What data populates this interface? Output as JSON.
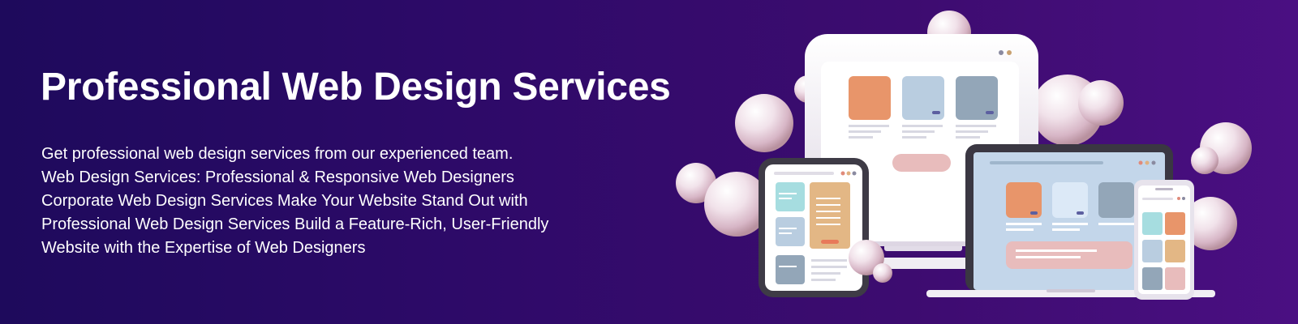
{
  "hero": {
    "heading": "Professional Web Design Services",
    "description_lines": [
      "Get professional web design services from our experienced team.",
      "Web Design Services: Professional & Responsive Web Designers",
      "Corporate Web Design Services Make Your Website Stand Out with",
      "Professional Web Design Services Build a Feature-Rich, User-Friendly",
      "Website with the Expertise of Web Designers"
    ]
  },
  "illustration": {
    "devices": [
      "desktop-monitor",
      "tablet",
      "laptop",
      "smartphone"
    ],
    "decorations": [
      "pearl-spheres"
    ]
  },
  "colors": {
    "background_start": "#1e0a5c",
    "background_end": "#4a0f82",
    "text": "#ffffff",
    "card_orange": "#e8956a",
    "card_blue": "#b9cde0",
    "card_slate": "#93a6b8",
    "card_teal": "#a6dde0",
    "card_sand": "#e3b785",
    "pill_pink": "#e8bcbc"
  }
}
